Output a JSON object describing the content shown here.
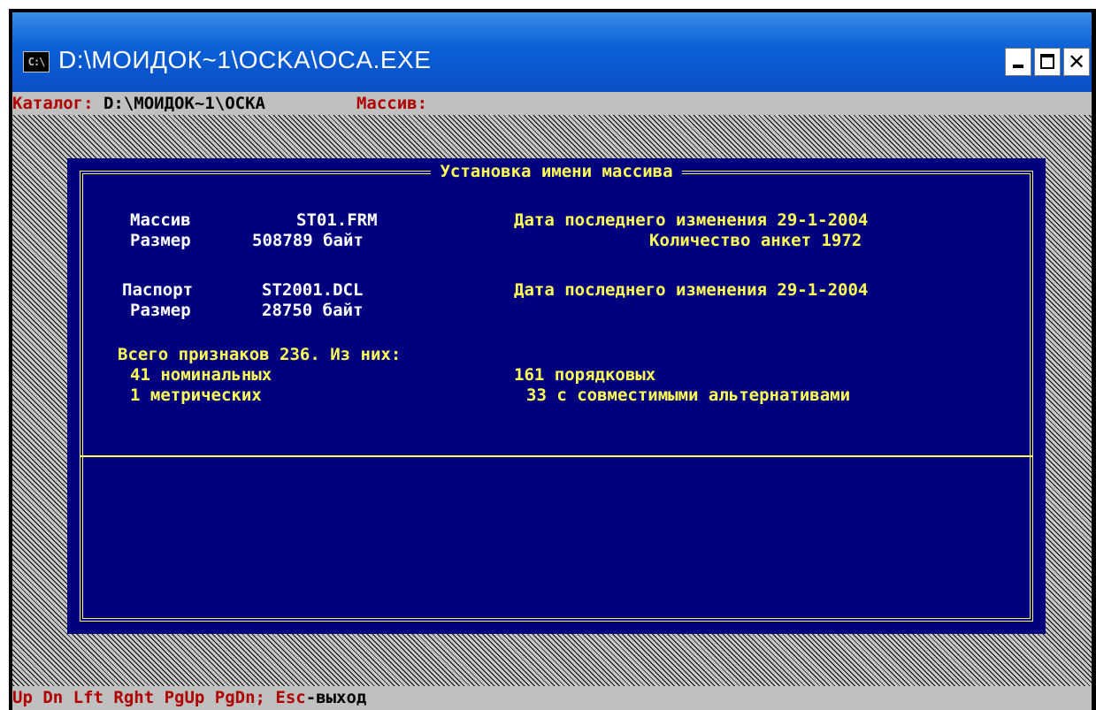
{
  "window": {
    "icon_text": "C:\\",
    "title": "D:\\МОИДОК~1\\OCKA\\OCA.EXE"
  },
  "status_bar": {
    "catalog_label": "Каталог:",
    "catalog_value": "D:\\МОИДОК~1\\ОСКА",
    "array_label": "Массив:"
  },
  "dialog": {
    "title": "Установка имени массива",
    "array_label": "Массив",
    "array_value": "ST01.FRM",
    "array_modified": "Дата последнего изменения 29-1-2004",
    "array_size_label": "Размер",
    "array_size_value": "508789 байт",
    "array_count": "Количество анкет 1972",
    "passport_label": "Паспорт",
    "passport_value": "ST2001.DCL",
    "passport_modified": "Дата последнего изменения 29-1-2004",
    "passport_size_label": "Размер",
    "passport_size_value": "28750 байт",
    "features_total": "Всего признаков 236. Из них:",
    "nominal": "41 номинальных",
    "ordinal": "161 порядковых",
    "metric": "1 метрических",
    "compatible": "33 с совместимыми альтернативами"
  },
  "footer": {
    "keys": "Up Dn Lft Rght PgUp PgDn; Esc",
    "exit": "-выход"
  },
  "colors": {
    "dialog_bg": "#00007f",
    "yellow_text": "#ffff55",
    "white_text": "#ffffff",
    "status_label": "#b00000"
  }
}
